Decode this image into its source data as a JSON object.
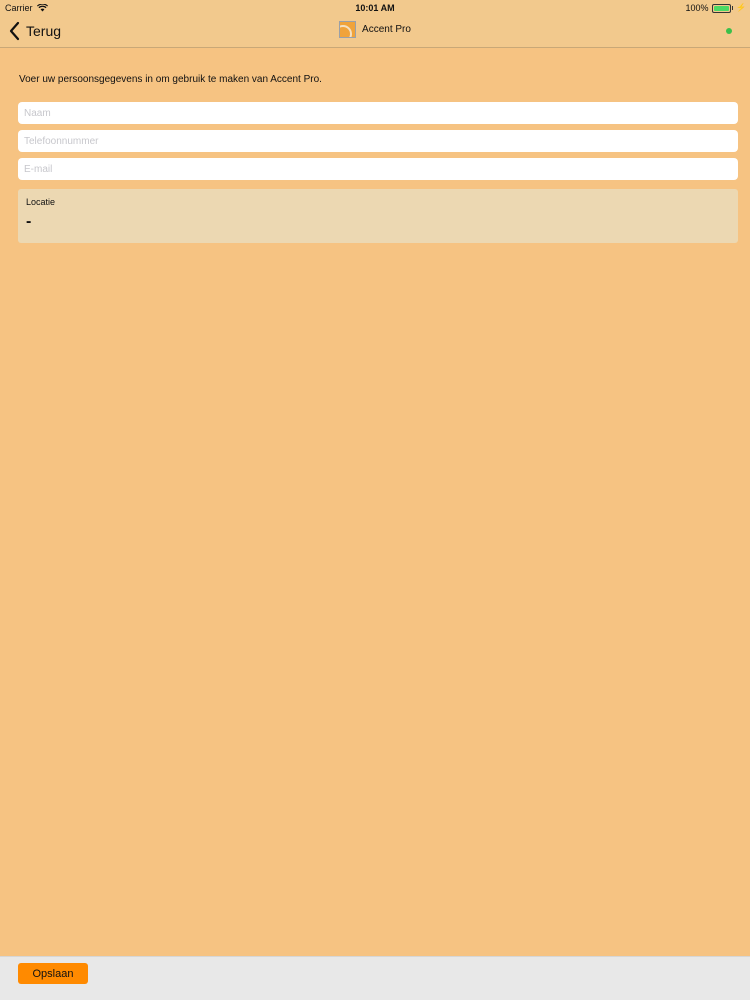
{
  "status_bar": {
    "carrier": "Carrier",
    "time": "10:01 AM",
    "battery": "100%",
    "battery_level": 1.0
  },
  "nav": {
    "back_label": "Terug",
    "title": "Accent Pro",
    "status_dot_color": "#3ac04a"
  },
  "form": {
    "intro": "Voer uw persoonsgegevens in om gebruik te maken van Accent Pro.",
    "name": {
      "placeholder": "Naam",
      "value": ""
    },
    "phone": {
      "placeholder": "Telefoonnummer",
      "value": ""
    },
    "email": {
      "placeholder": "E-mail",
      "value": ""
    },
    "location": {
      "label": "Locatie",
      "value": "-"
    }
  },
  "toolbar": {
    "save_label": "Opslaan"
  },
  "colors": {
    "background": "#f6c382",
    "accent": "#ff8a00"
  }
}
